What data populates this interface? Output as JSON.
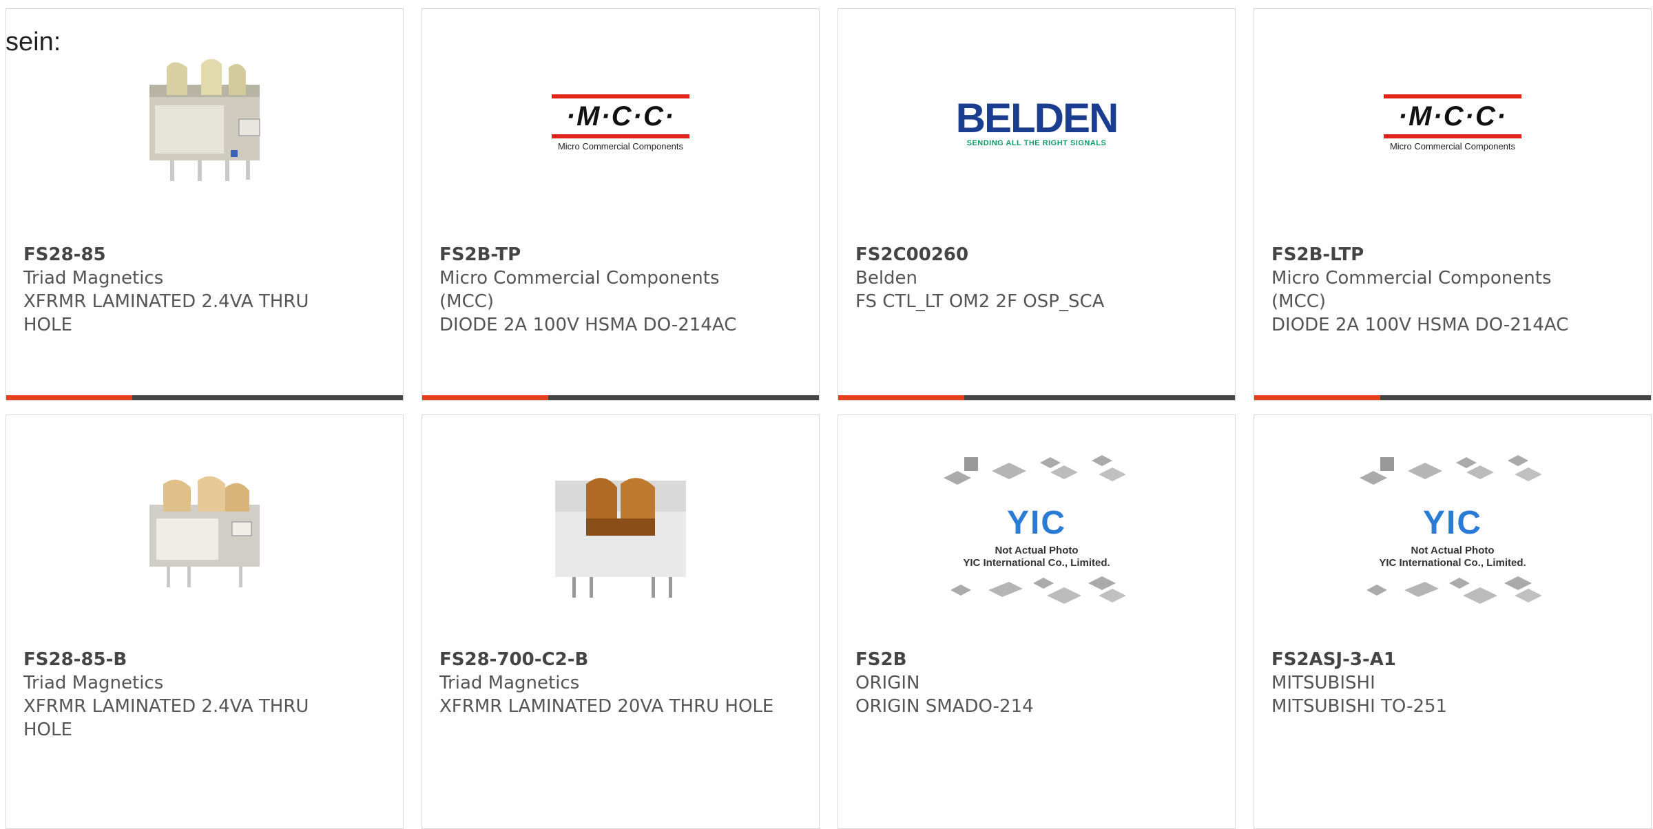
{
  "lead_text": "sein:",
  "cards": [
    {
      "part": "FS28-85",
      "manufacturer": "Triad Magnetics",
      "description": "XFRMR LAMINATED 2.4VA THRU HOLE",
      "image": "transformer-photo"
    },
    {
      "part": "FS2B-TP",
      "manufacturer": "Micro Commercial Components (MCC)",
      "description": "DIODE 2A 100V HSMA DO-214AC",
      "image": "mcc-logo"
    },
    {
      "part": "FS2C00260",
      "manufacturer": "Belden",
      "description": "FS CTL_LT OM2 2F OSP_SCA",
      "image": "belden-logo"
    },
    {
      "part": "FS2B-LTP",
      "manufacturer": "Micro Commercial Components (MCC)",
      "description": "DIODE 2A 100V HSMA DO-214AC",
      "image": "mcc-logo"
    },
    {
      "part": "FS28-85-B",
      "manufacturer": "Triad Magnetics",
      "description": "XFRMR LAMINATED 2.4VA THRU HOLE",
      "image": "transformer-photo"
    },
    {
      "part": "FS28-700-C2-B",
      "manufacturer": "Triad Magnetics",
      "description": "XFRMR LAMINATED 20VA THRU HOLE",
      "image": "transformer-photo"
    },
    {
      "part": "FS2B",
      "manufacturer": "ORIGIN",
      "description": "ORIGIN SMADO-214",
      "image": "yic-placeholder"
    },
    {
      "part": "FS2ASJ-3-A1",
      "manufacturer": "MITSUBISHI",
      "description": "MITSUBISHI TO-251",
      "image": "yic-placeholder"
    }
  ],
  "logos": {
    "mcc_mark": "·M·C·C·",
    "mcc_sub": "Micro Commercial Components",
    "belden_word": "BELDEN",
    "belden_tag": "SENDING ALL THE RIGHT SIGNALS",
    "yic_mark": "YIC",
    "yic_note_1": "Not Actual Photo",
    "yic_note_2": "YIC International Co., Limited."
  },
  "colors": {
    "accent": "#e8401c",
    "bar": "#444444",
    "mcc_red": "#e2231a",
    "belden_blue": "#1b3d8f",
    "belden_green": "#0f9a66"
  }
}
